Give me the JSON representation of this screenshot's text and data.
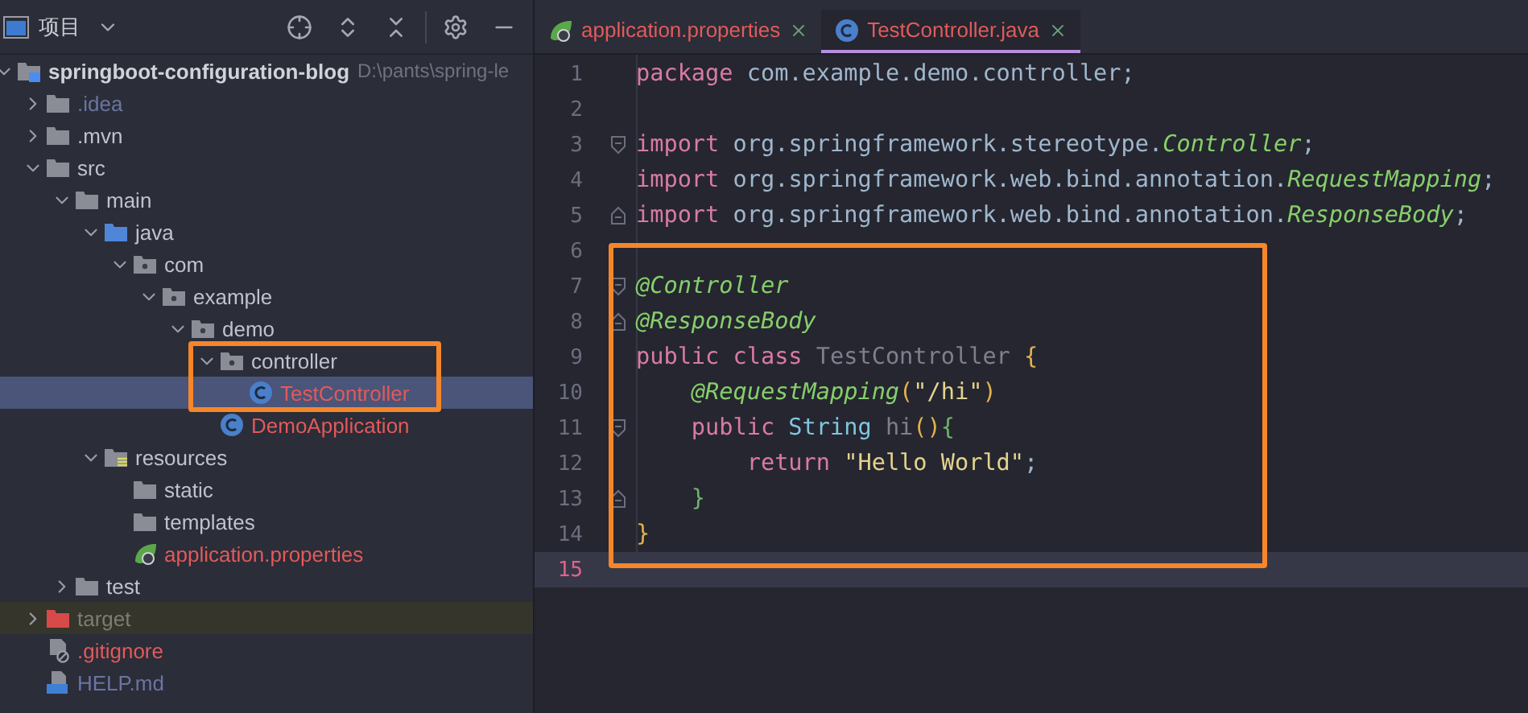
{
  "project_panel": {
    "title": "项目"
  },
  "tree": {
    "label": "springboot-configuration-blog",
    "path": "D:\\pants\\spring-le",
    "kind": "module",
    "color": "#d0d3da",
    "expanded": true,
    "selected": false,
    "children": [
      {
        "label": ".idea",
        "kind": "folder",
        "color": "#6b75a3",
        "expanded": false,
        "selected": false
      },
      {
        "label": ".mvn",
        "kind": "folder",
        "color": "#bfc3cc",
        "expanded": false,
        "selected": false
      },
      {
        "label": "src",
        "kind": "folder",
        "color": "#bfc3cc",
        "expanded": true,
        "selected": false,
        "children": [
          {
            "label": "main",
            "kind": "folder",
            "color": "#bfc3cc",
            "expanded": true,
            "selected": false,
            "children": [
              {
                "label": "java",
                "kind": "source-folder",
                "color": "#bfc3cc",
                "expanded": true,
                "selected": false,
                "children": [
                  {
                    "label": "com",
                    "kind": "package",
                    "color": "#bfc3cc",
                    "expanded": true,
                    "selected": false,
                    "children": [
                      {
                        "label": "example",
                        "kind": "package",
                        "color": "#bfc3cc",
                        "expanded": true,
                        "selected": false,
                        "children": [
                          {
                            "label": "demo",
                            "kind": "package",
                            "color": "#bfc3cc",
                            "expanded": true,
                            "selected": false,
                            "children": [
                              {
                                "label": "controller",
                                "kind": "package",
                                "color": "#bfc3cc",
                                "expanded": true,
                                "selected": false,
                                "outlined": true,
                                "children": [
                                  {
                                    "label": "TestController",
                                    "kind": "class",
                                    "color": "#e25a5a",
                                    "selected": true
                                  }
                                ]
                              },
                              {
                                "label": "DemoApplication",
                                "kind": "class",
                                "color": "#e25a5a",
                                "selected": false
                              }
                            ]
                          }
                        ]
                      }
                    ]
                  }
                ]
              },
              {
                "label": "resources",
                "kind": "resources-folder",
                "color": "#bfc3cc",
                "expanded": true,
                "selected": false,
                "children": [
                  {
                    "label": "static",
                    "kind": "folder",
                    "color": "#bfc3cc",
                    "selected": false
                  },
                  {
                    "label": "templates",
                    "kind": "folder",
                    "color": "#bfc3cc",
                    "selected": false
                  },
                  {
                    "label": "application.properties",
                    "kind": "properties",
                    "color": "#e25a5a",
                    "selected": false
                  }
                ]
              }
            ]
          },
          {
            "label": "test",
            "kind": "folder",
            "color": "#bfc3cc",
            "expanded": false,
            "selected": false
          }
        ]
      },
      {
        "label": "target",
        "kind": "excluded-folder",
        "color": "#7f7d70",
        "expanded": false,
        "selected": false
      },
      {
        "label": ".gitignore",
        "kind": "gitignore",
        "color": "#e25a5a",
        "selected": false
      },
      {
        "label": "HELP.md",
        "kind": "markdown",
        "color": "#6b75a3",
        "selected": false
      }
    ]
  },
  "tabs": [
    {
      "label": "application.properties",
      "kind": "properties",
      "selected": false
    },
    {
      "label": "TestController.java",
      "kind": "class",
      "selected": true
    }
  ],
  "code_blocks": [
    {
      "lines": [
        {
          "number": "1",
          "tokens": [
            {
              "text": "package",
              "kind": "keyword"
            },
            {
              "text": " com.example.demo.controller;",
              "kind": "plain"
            }
          ]
        },
        {
          "number": "2"
        },
        {
          "number": "3",
          "fold_start": true,
          "tokens": [
            {
              "text": "import",
              "kind": "keyword"
            },
            {
              "text": " org.springframework.stereotype.",
              "kind": "plain"
            },
            {
              "text": "Controller",
              "kind": "annotation"
            },
            {
              "text": ";",
              "kind": "plain"
            }
          ]
        },
        {
          "number": "4",
          "tokens": [
            {
              "text": "import",
              "kind": "keyword"
            },
            {
              "text": " org.springframework.web.bind.annotation.",
              "kind": "plain"
            },
            {
              "text": "RequestMapping",
              "kind": "annotation"
            },
            {
              "text": ";",
              "kind": "plain"
            }
          ]
        },
        {
          "number": "5",
          "fold_end": true,
          "tokens": [
            {
              "text": "import",
              "kind": "keyword"
            },
            {
              "text": " org.springframework.web.bind.annotation.",
              "kind": "plain"
            },
            {
              "text": "ResponseBody",
              "kind": "annotation"
            },
            {
              "text": ";",
              "kind": "plain"
            }
          ]
        }
      ]
    },
    {
      "outlined": true,
      "lines": [
        {
          "number": "6"
        },
        {
          "number": "7",
          "fold_start": true,
          "tokens": [
            {
              "text": "@Controller",
              "kind": "annotation"
            }
          ]
        },
        {
          "number": "8",
          "fold_end": true,
          "tokens": [
            {
              "text": "@ResponseBody",
              "kind": "annotation"
            }
          ]
        },
        {
          "number": "9",
          "tokens": [
            {
              "text": "public class",
              "kind": "keyword"
            },
            {
              "text": " TestController",
              "kind": "unused"
            },
            {
              "text": " {",
              "kind": "brace"
            }
          ]
        },
        {
          "number": "10",
          "tokens": [
            {
              "text": "    @RequestMapping",
              "kind": "annotation"
            },
            {
              "text": "(",
              "kind": "brace"
            },
            {
              "text": "\"/hi\"",
              "kind": "string"
            },
            {
              "text": ")",
              "kind": "brace"
            }
          ]
        },
        {
          "number": "11",
          "fold_start": true,
          "tokens": [
            {
              "text": "    public",
              "kind": "keyword"
            },
            {
              "text": " String",
              "kind": "type"
            },
            {
              "text": " hi",
              "kind": "unused"
            },
            {
              "text": "()",
              "kind": "brace"
            },
            {
              "text": "{",
              "kind": "inner-brace"
            }
          ]
        },
        {
          "number": "12",
          "tokens": [
            {
              "text": "        return",
              "kind": "keyword"
            },
            {
              "text": " \"Hello World\"",
              "kind": "string"
            },
            {
              "text": ";",
              "kind": "plain"
            }
          ]
        },
        {
          "number": "13",
          "fold_end": true,
          "tokens": [
            {
              "text": "    }",
              "kind": "inner-brace"
            }
          ]
        },
        {
          "number": "14",
          "tokens": [
            {
              "text": "}",
              "kind": "brace"
            }
          ]
        },
        {
          "number": "15",
          "current": true
        }
      ]
    }
  ]
}
